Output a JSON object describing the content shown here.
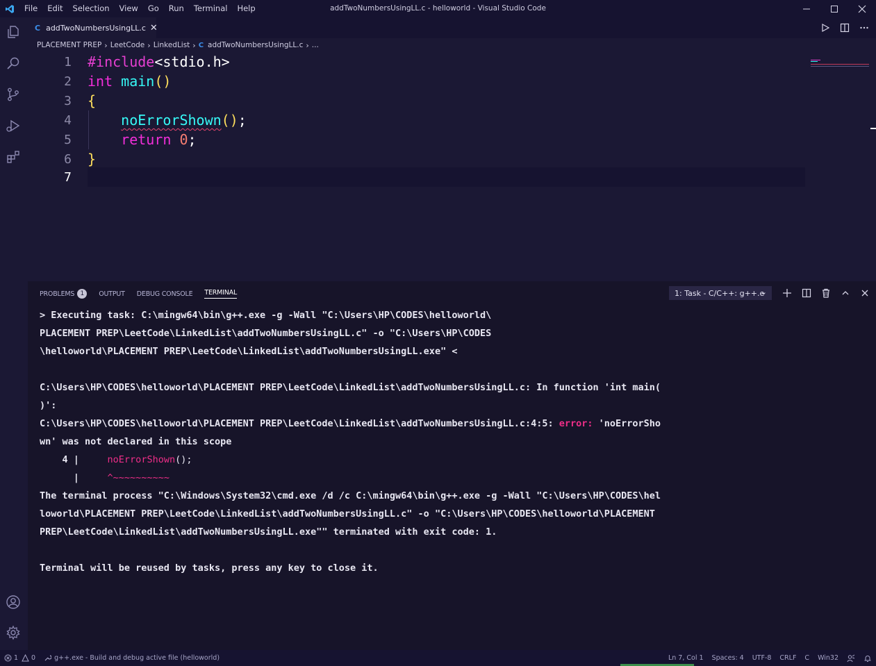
{
  "window": {
    "title": "addTwoNumbersUsingLL.c - helloworld - Visual Studio Code",
    "menu": [
      "File",
      "Edit",
      "Selection",
      "View",
      "Go",
      "Run",
      "Terminal",
      "Help"
    ]
  },
  "colors": {
    "background": "#1b1834",
    "keyword": "#f22ed9",
    "function": "#36f9f6",
    "punctuation": "#fede5d",
    "error": "#ef2e88"
  },
  "tab": {
    "icon": "C",
    "label": "addTwoNumbersUsingLL.c",
    "close": "✕"
  },
  "breadcrumb": {
    "items": [
      "PLACEMENT PREP",
      "LeetCode",
      "LinkedList"
    ],
    "file_icon": "C",
    "file": "addTwoNumbersUsingLL.c",
    "ellipsis": "..."
  },
  "editor": {
    "line_numbers": [
      "1",
      "2",
      "3",
      "4",
      "5",
      "6",
      "7"
    ],
    "tokens": {
      "l1_pp": "#include",
      "l1_hdr": "<stdio.h>",
      "l2_kw": "int",
      "l2_fn": "main",
      "l2_paren": "()",
      "l3_brace": "{",
      "l4_fn": "noErrorShown",
      "l4_paren": "()",
      "l4_semi": ";",
      "l5_kw": "return",
      "l5_num": "0",
      "l5_semi": ";",
      "l6_brace": "}"
    }
  },
  "panel": {
    "tabs": {
      "problems": "PROBLEMS",
      "problems_count": "1",
      "output": "OUTPUT",
      "debug_console": "DEBUG CONSOLE",
      "terminal": "TERMINAL"
    },
    "task_select": "1: Task - C/C++: g++.e"
  },
  "terminal": {
    "l1": "> Executing task: C:\\mingw64\\bin\\g++.exe -g -Wall \"C:\\Users\\HP\\CODES\\helloworld\\",
    "l2": "PLACEMENT PREP\\LeetCode\\LinkedList\\addTwoNumbersUsingLL.c\" -o \"C:\\Users\\HP\\CODES",
    "l3": "\\helloworld\\PLACEMENT PREP\\LeetCode\\LinkedList\\addTwoNumbersUsingLL.exe\" <",
    "l4": "C:\\Users\\HP\\CODES\\helloworld\\PLACEMENT PREP\\LeetCode\\LinkedList\\addTwoNumbersUsingLL.c: In function 'int main(",
    "l5": ")':",
    "l6_prefix": "C:\\Users\\HP\\CODES\\helloworld\\PLACEMENT PREP\\LeetCode\\LinkedList\\addTwoNumbersUsingLL.c:4:5: ",
    "l6_error": "error:",
    "l6_suffix": " 'noErrorSho",
    "l7": "wn' was not declared in this scope",
    "l8_prefix": "    4 |     ",
    "l8_fn": "noErrorShown",
    "l8_suffix": "();",
    "l9_prefix": "      |     ",
    "l9_carets": "^~~~~~~~~~~",
    "l10": "The terminal process \"C:\\Windows\\System32\\cmd.exe /d /c C:\\mingw64\\bin\\g++.exe -g -Wall \"C:\\Users\\HP\\CODES\\hel",
    "l11": "loworld\\PLACEMENT PREP\\LeetCode\\LinkedList\\addTwoNumbersUsingLL.c\" -o \"C:\\Users\\HP\\CODES\\helloworld\\PLACEMENT",
    "l12": "PREP\\LeetCode\\LinkedList\\addTwoNumbersUsingLL.exe\"\" terminated with exit code: 1.",
    "l13": "Terminal will be reused by tasks, press any key to close it."
  },
  "statusbar": {
    "errors": "1",
    "warnings": "0",
    "task": "g++.exe - Build and debug active file (helloworld)",
    "position": "Ln 7, Col 1",
    "spaces": "Spaces: 4",
    "encoding": "UTF-8",
    "eol": "CRLF",
    "language": "C",
    "platform": "Win32"
  }
}
